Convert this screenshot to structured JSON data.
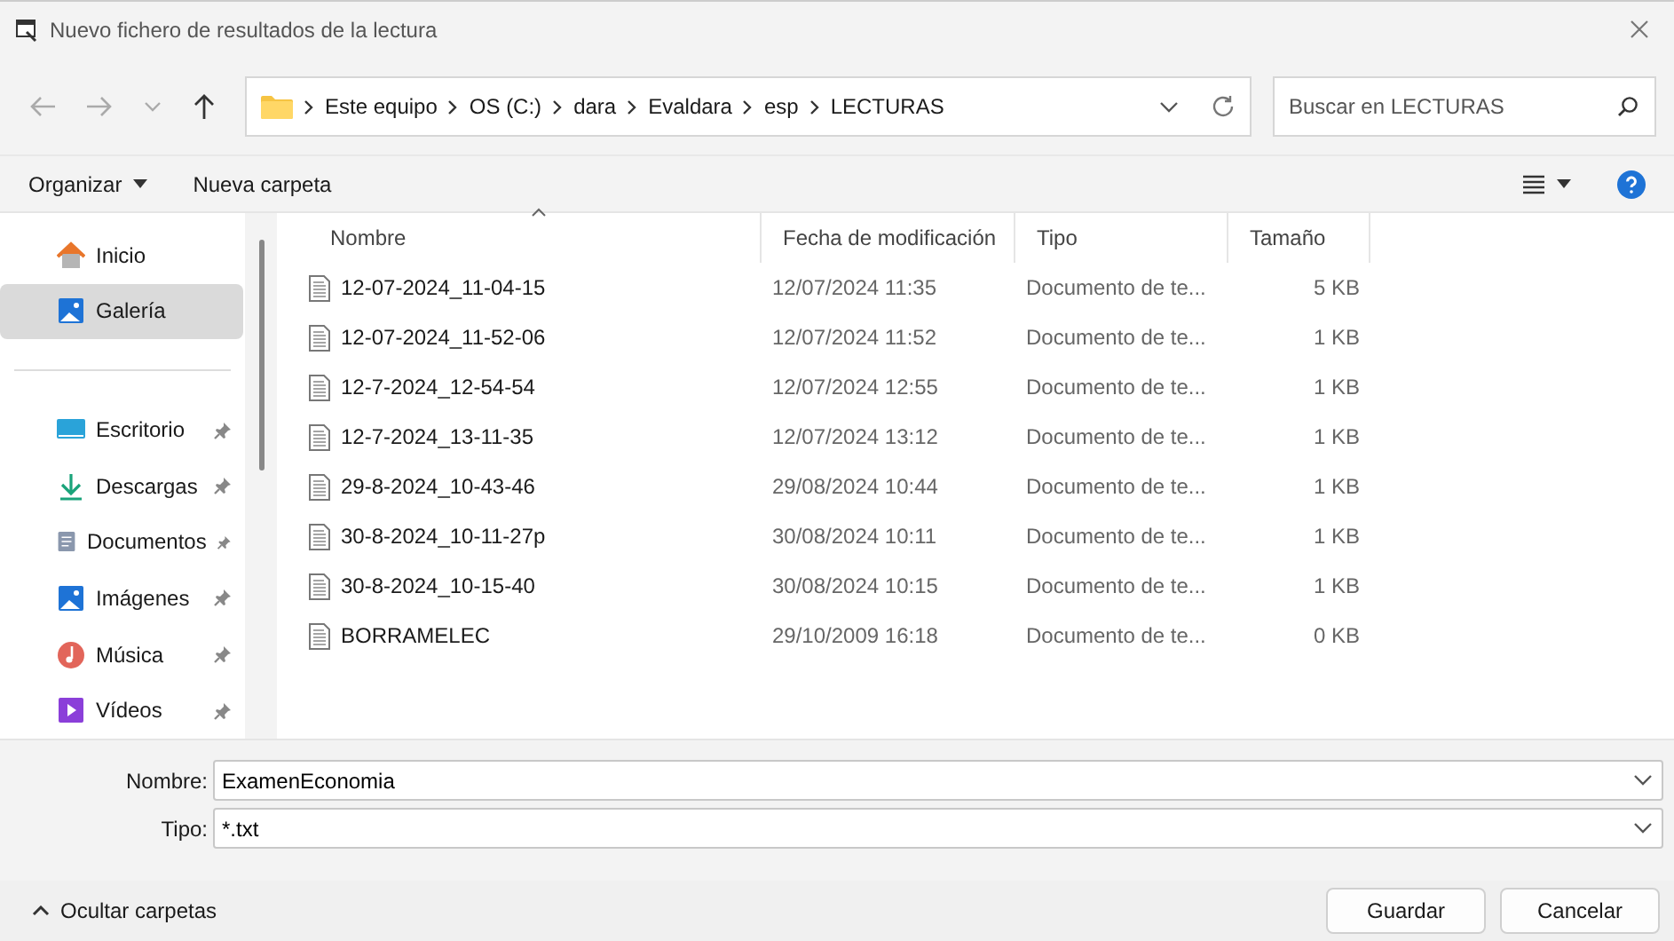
{
  "window": {
    "title": "Nuevo fichero de resultados de la lectura"
  },
  "address_bar": {
    "segments": [
      "Este equipo",
      "OS (C:)",
      "dara",
      "Evaldara",
      "esp",
      "LECTURAS"
    ]
  },
  "search": {
    "placeholder": "Buscar en LECTURAS"
  },
  "toolbar": {
    "organize": "Organizar",
    "new_folder": "Nueva carpeta"
  },
  "sidebar": {
    "items": [
      {
        "label": "Inicio",
        "kind": "home",
        "selected": false,
        "pinned": false
      },
      {
        "label": "Galería",
        "kind": "gallery",
        "selected": true,
        "pinned": false
      },
      {
        "label": "Escritorio",
        "kind": "desktop",
        "selected": false,
        "pinned": true
      },
      {
        "label": "Descargas",
        "kind": "downloads",
        "selected": false,
        "pinned": true
      },
      {
        "label": "Documentos",
        "kind": "documents",
        "selected": false,
        "pinned": true
      },
      {
        "label": "Imágenes",
        "kind": "pictures",
        "selected": false,
        "pinned": true
      },
      {
        "label": "Música",
        "kind": "music",
        "selected": false,
        "pinned": true
      },
      {
        "label": "Vídeos",
        "kind": "videos",
        "selected": false,
        "pinned": true
      }
    ]
  },
  "table": {
    "columns": [
      "Nombre",
      "Fecha de modificación",
      "Tipo",
      "Tamaño"
    ],
    "rows": [
      [
        "12-07-2024_11-04-15",
        "12/07/2024 11:35",
        "Documento de te...",
        "5 KB"
      ],
      [
        "12-07-2024_11-52-06",
        "12/07/2024 11:52",
        "Documento de te...",
        "1 KB"
      ],
      [
        "12-7-2024_12-54-54",
        "12/07/2024 12:55",
        "Documento de te...",
        "1 KB"
      ],
      [
        "12-7-2024_13-11-35",
        "12/07/2024 13:12",
        "Documento de te...",
        "1 KB"
      ],
      [
        "29-8-2024_10-43-46",
        "29/08/2024 10:44",
        "Documento de te...",
        "1 KB"
      ],
      [
        "30-8-2024_10-11-27p",
        "30/08/2024 10:11",
        "Documento de te...",
        "1 KB"
      ],
      [
        "30-8-2024_10-15-40",
        "30/08/2024 10:15",
        "Documento de te...",
        "1 KB"
      ],
      [
        "BORRAMELEC",
        "29/10/2009 16:18",
        "Documento de te...",
        "0 KB"
      ]
    ]
  },
  "form": {
    "name_label": "Nombre:",
    "name_value": "ExamenEconomia",
    "type_label": "Tipo:",
    "type_value": "*.txt"
  },
  "footer": {
    "toggle": "Ocultar carpetas",
    "buttons": [
      "Guardar",
      "Cancelar"
    ]
  }
}
